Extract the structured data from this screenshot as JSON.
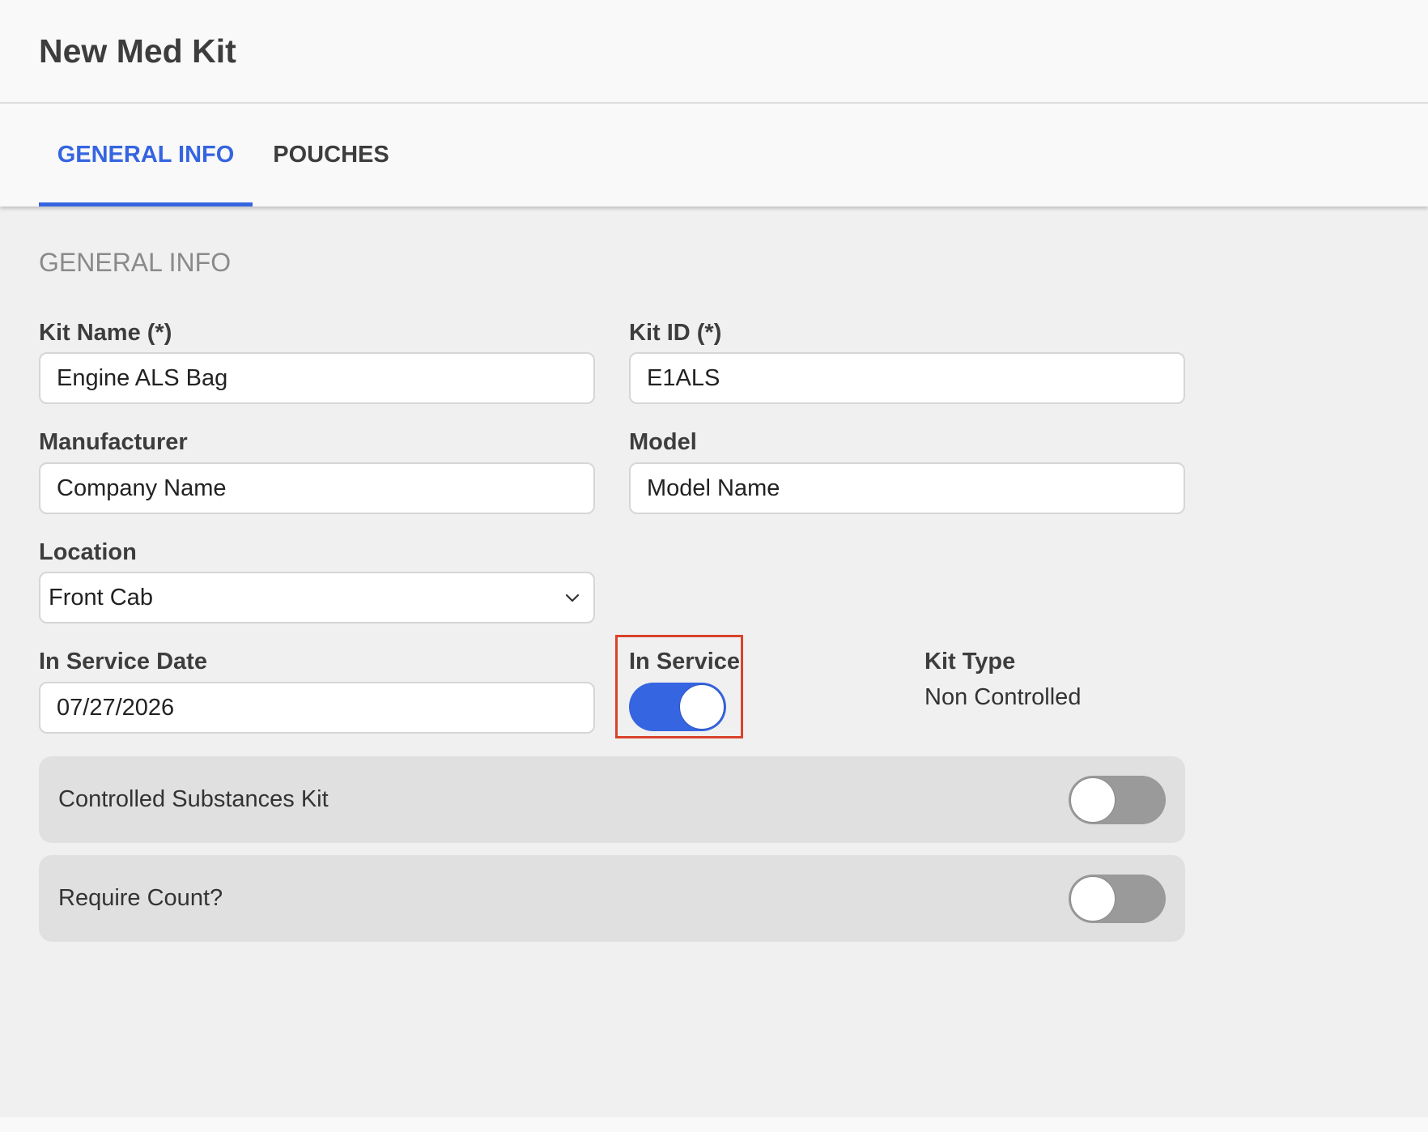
{
  "header": {
    "title": "New Med Kit"
  },
  "tabs": {
    "general": "GENERAL INFO",
    "pouches": "POUCHES",
    "active": "general"
  },
  "section": {
    "title": "GENERAL INFO"
  },
  "form": {
    "kit_name": {
      "label": "Kit Name (*)",
      "value": "Engine ALS Bag"
    },
    "kit_id": {
      "label": "Kit ID (*)",
      "value": "E1ALS"
    },
    "manufacturer": {
      "label": "Manufacturer",
      "placeholder": "Company Name"
    },
    "model": {
      "label": "Model",
      "placeholder": "Model Name"
    },
    "location": {
      "label": "Location",
      "value": "Front Cab",
      "icon": "chevron-down-icon"
    },
    "in_service_date": {
      "label": "In Service Date",
      "value": "07/27/2026"
    },
    "in_service": {
      "label": "In Service",
      "enabled": true
    },
    "kit_type": {
      "label": "Kit Type",
      "value": "Non Controlled"
    }
  },
  "switches": {
    "controlled_substances": {
      "label": "Controlled Substances Kit",
      "enabled": false
    },
    "require_count": {
      "label": "Require Count?",
      "enabled": false
    }
  },
  "colors": {
    "accent": "#3565e0",
    "highlight": "#d9432c",
    "toggle_off": "#9a9a9a"
  }
}
